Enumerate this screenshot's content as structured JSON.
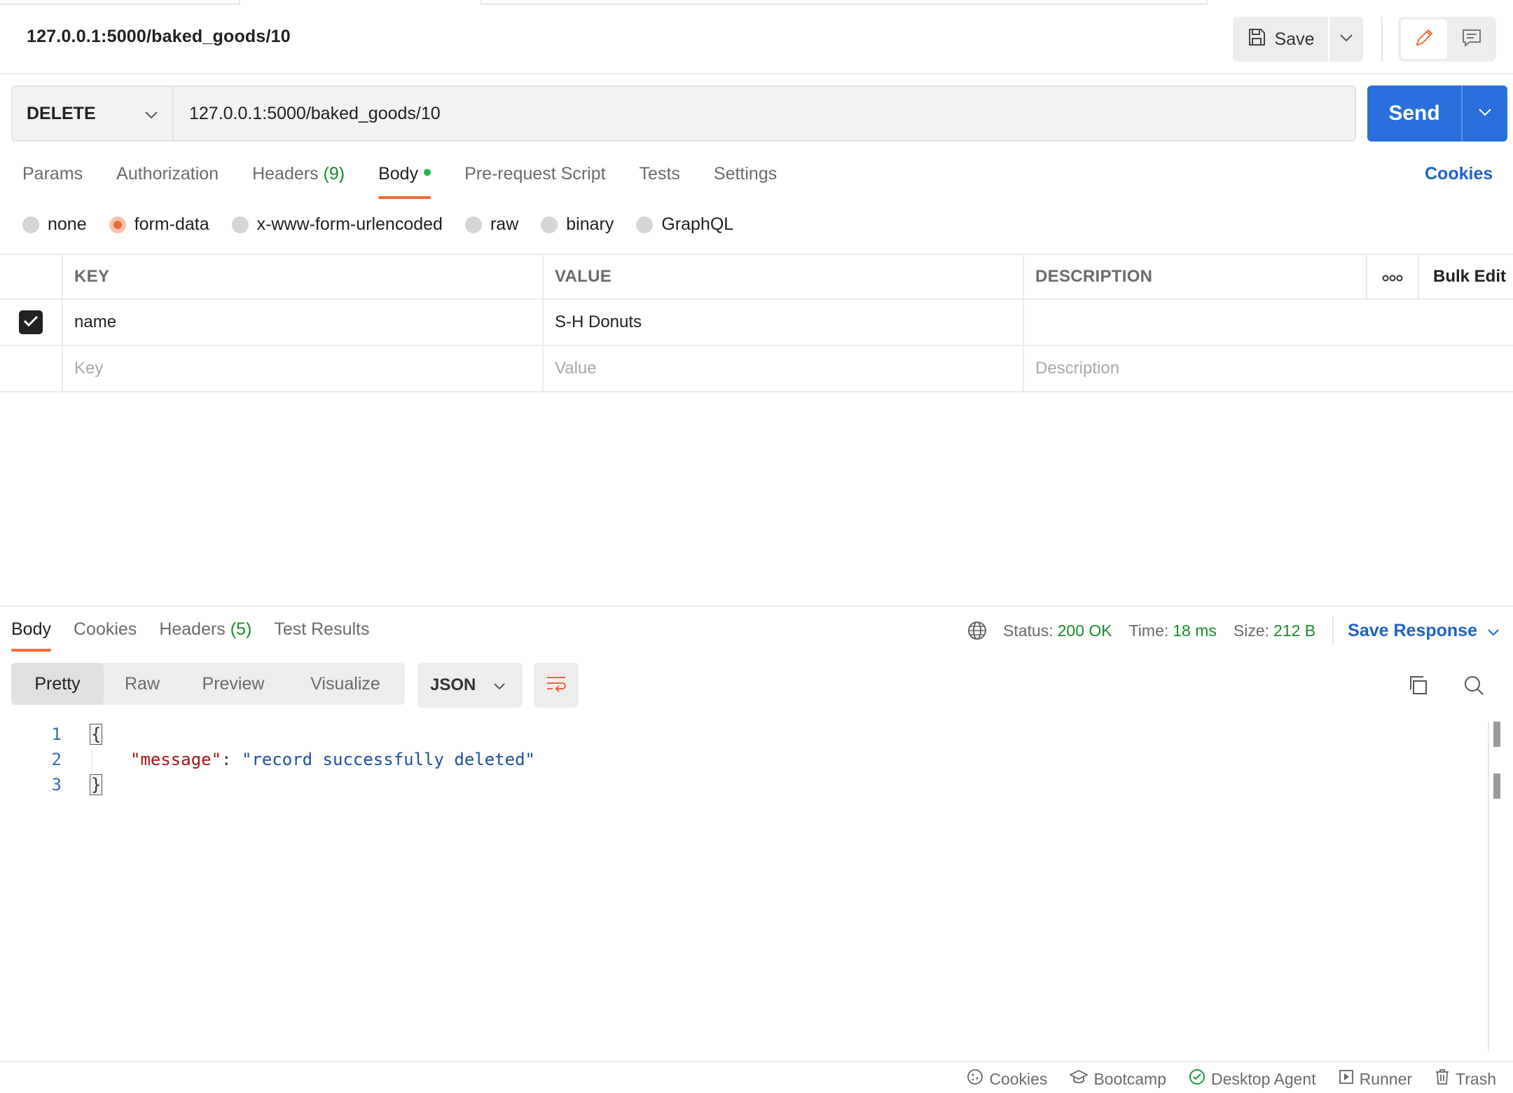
{
  "header": {
    "request_title": "127.0.0.1:5000/baked_goods/10",
    "save_label": "Save"
  },
  "request": {
    "method": "DELETE",
    "url": "127.0.0.1:5000/baked_goods/10",
    "send_label": "Send"
  },
  "request_tabs": [
    {
      "label": "Params"
    },
    {
      "label": "Authorization"
    },
    {
      "label": "Headers",
      "count": "(9)"
    },
    {
      "label": "Body",
      "active": true
    },
    {
      "label": "Pre-request Script"
    },
    {
      "label": "Tests"
    },
    {
      "label": "Settings"
    }
  ],
  "cookies_link": "Cookies",
  "body_types": [
    {
      "label": "none",
      "selected": false
    },
    {
      "label": "form-data",
      "selected": true
    },
    {
      "label": "x-www-form-urlencoded",
      "selected": false
    },
    {
      "label": "raw",
      "selected": false
    },
    {
      "label": "binary",
      "selected": false
    },
    {
      "label": "GraphQL",
      "selected": false
    }
  ],
  "form_table": {
    "headers": {
      "key": "KEY",
      "value": "VALUE",
      "description": "DESCRIPTION",
      "bulk_edit": "Bulk Edit"
    },
    "rows": [
      {
        "checked": true,
        "key": "name",
        "value": "S-H Donuts",
        "description": ""
      }
    ],
    "placeholders": {
      "key": "Key",
      "value": "Value",
      "description": "Description"
    }
  },
  "response": {
    "tabs": [
      {
        "label": "Body",
        "active": true
      },
      {
        "label": "Cookies"
      },
      {
        "label": "Headers",
        "count": "(5)"
      },
      {
        "label": "Test Results"
      }
    ],
    "status_label": "Status:",
    "status_value": "200 OK",
    "time_label": "Time:",
    "time_value": "18 ms",
    "size_label": "Size:",
    "size_value": "212 B",
    "save_response_label": "Save Response",
    "views": [
      "Pretty",
      "Raw",
      "Preview",
      "Visualize"
    ],
    "active_view": "Pretty",
    "format": "JSON",
    "code": {
      "line_numbers": [
        "1",
        "2",
        "3"
      ],
      "open_brace": "{",
      "key": "\"message\"",
      "colon": ": ",
      "value": "\"record successfully deleted\"",
      "close_brace": "}"
    }
  },
  "footer": {
    "items": [
      "Cookies",
      "Bootcamp",
      "Desktop Agent",
      "Runner",
      "Trash"
    ]
  },
  "colors": {
    "accent_orange": "#f26b3a",
    "send_blue": "#2a6fdb",
    "link_blue": "#1f63c8",
    "status_green": "#1a8a2f"
  }
}
